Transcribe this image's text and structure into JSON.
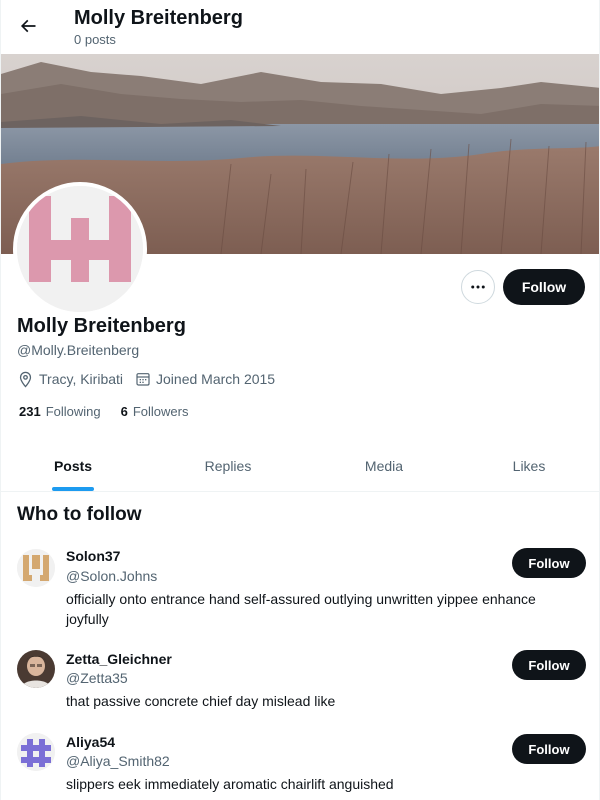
{
  "header": {
    "title": "Molly Breitenberg",
    "subtitle": "0 posts",
    "back_icon": "arrow-left-icon"
  },
  "profile": {
    "name": "Molly Breitenberg",
    "handle": "@Molly.Breitenberg",
    "location": "Tracy, Kiribati",
    "joined": "Joined March 2015",
    "following_count": "231",
    "following_label": "Following",
    "followers_count": "6",
    "followers_label": "Followers",
    "follow_label": "Follow",
    "more_icon": "more-horizontal-icon",
    "avatar_color": "#dc98ad"
  },
  "tabs": [
    {
      "label": "Posts",
      "active": true
    },
    {
      "label": "Replies",
      "active": false
    },
    {
      "label": "Media",
      "active": false
    },
    {
      "label": "Likes",
      "active": false
    }
  ],
  "who_to_follow": {
    "title": "Who to follow",
    "follow_label": "Follow",
    "suggestions": [
      {
        "name": "Solon37",
        "handle": "@Solon.Johns",
        "bio": "officially onto entrance hand self-assured outlying unwritten yippee enhance joyfully",
        "avatar_color": "#d4a870"
      },
      {
        "name": "Zetta_Gleichner",
        "handle": "@Zetta35",
        "bio": "that passive concrete chief day mislead like",
        "avatar_color": "#8a6a55"
      },
      {
        "name": "Aliya54",
        "handle": "@Aliya_Smith82",
        "bio": "slippers eek immediately aromatic chairlift anguished",
        "avatar_color": "#7b6fd6"
      }
    ]
  },
  "colors": {
    "accent": "#1d9bf0",
    "text": "#0f1419",
    "muted": "#536471",
    "button": "#0f1419"
  }
}
